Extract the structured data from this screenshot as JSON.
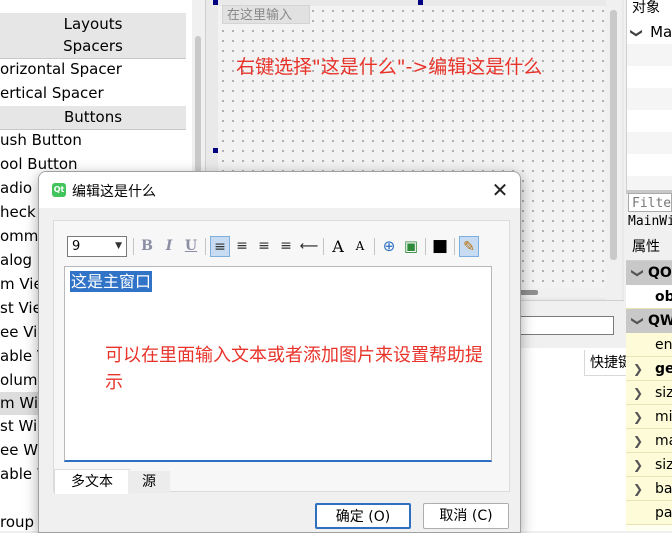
{
  "widget_box": {
    "categories": {
      "layouts": "Layouts",
      "spacers": "Spacers",
      "buttons": "Buttons"
    },
    "spacers": [
      "orizontal Spacer",
      "ertical Spacer"
    ],
    "buttons": [
      "ush Button",
      "ool Button",
      "adio B",
      "heck B",
      "omma",
      "alog "
    ],
    "item_views": [
      "m Vie",
      "st Vie",
      "ee Vi",
      "able V",
      "olumn",
      "m Wid",
      "st Wid",
      "ee Wi",
      "able W"
    ],
    "bottom_item": "roup "
  },
  "form": {
    "input_placeholder": "在这里输入",
    "hint": "右键选择\"这是什么\"->编辑这是什么"
  },
  "object_inspector": {
    "title": "对象",
    "root_item": "Ma",
    "root_expander": "❯"
  },
  "property_editor": {
    "filter_placeholder": "Filter",
    "class_label": "MainWi",
    "header": "属性",
    "groups": [
      "QO",
      "QW"
    ],
    "qobject_rows": [
      {
        "expander": "",
        "name": "ob"
      }
    ],
    "qwidget_rows": [
      {
        "expander": "",
        "name": "en"
      },
      {
        "expander": "❯",
        "name": "ge"
      },
      {
        "expander": "❯",
        "name": "siz"
      },
      {
        "expander": "❯",
        "name": "mi"
      },
      {
        "expander": "❯",
        "name": "ma"
      },
      {
        "expander": "❯",
        "name": "siz"
      },
      {
        "expander": "❯",
        "name": "ba"
      },
      {
        "expander": "",
        "name": "pa"
      }
    ]
  },
  "action_editor": {
    "shortcut_header": "快捷键"
  },
  "dialog": {
    "icon_text": "Qt",
    "title": "编辑这是什么",
    "close_glyph": "✕",
    "font_size": "9",
    "dropdown_glyph": "▼",
    "toolbar": {
      "bold": "B",
      "italic": "I",
      "underline": "U",
      "align_left": "≡",
      "align_center": "≡",
      "align_right": "≡",
      "justify": "≡",
      "ltr": "⟵",
      "font_larger": "A",
      "font_smaller": "A",
      "link": "⊕",
      "image": "▣",
      "color": "■",
      "simplify": "✎"
    },
    "content_text": "这是主窗口",
    "annotation": "可以在里面输入文本或者添加图片来设置帮助提示",
    "tabs": {
      "rich": "多文本",
      "source": "源"
    },
    "ok_label": "确定 (O)",
    "cancel_label": "取消 (C)"
  },
  "colors": {
    "accent_blue": "#2f6fbf",
    "selection": "#3073c7",
    "annotation_red": "#e8332a",
    "property_yellow": "#fdfbd8"
  }
}
